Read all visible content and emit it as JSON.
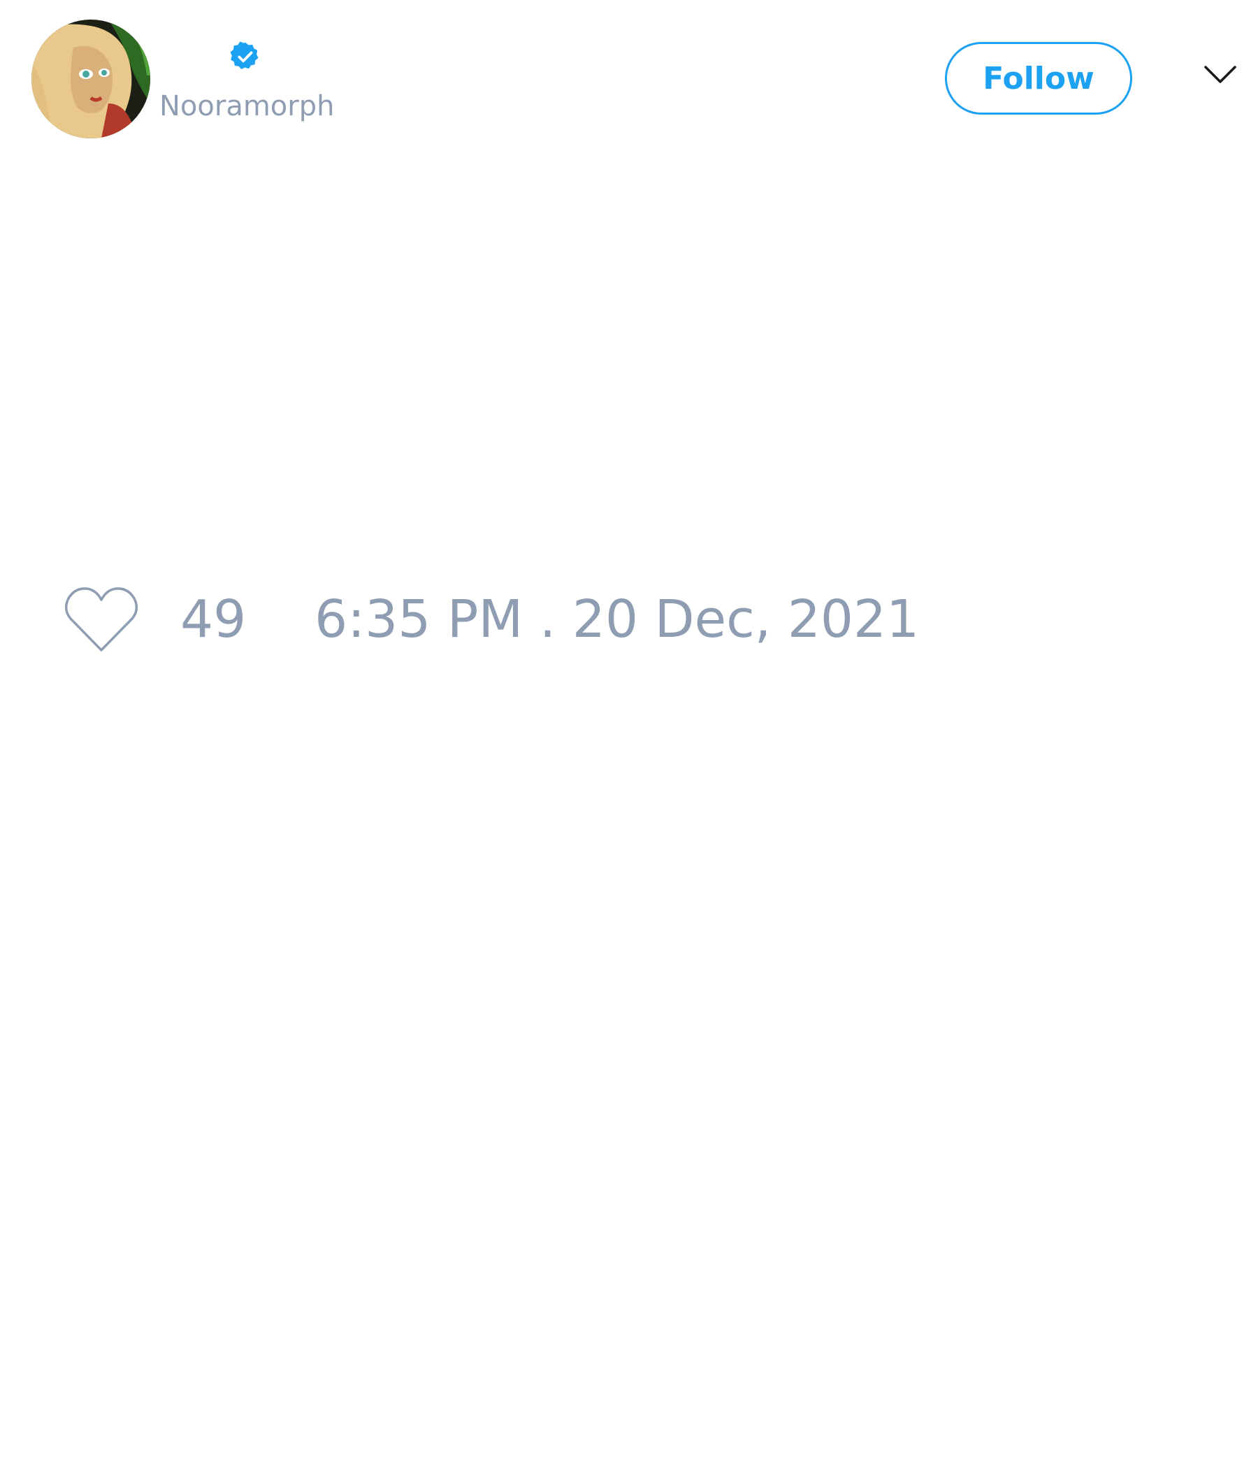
{
  "tweet": {
    "author": {
      "username": "Nooramorph",
      "verified": true,
      "avatar_icon": "cartoon-avatar"
    },
    "follow_label": "Follow",
    "menu_icon": "chevron-down-icon",
    "like_icon": "heart-outline-icon",
    "like_count": "49",
    "timestamp": "6:35 PM . 20 Dec, 2021"
  },
  "colors": {
    "accent": "#1da1f2",
    "muted_text": "#8f9db3",
    "background": "#ffffff"
  }
}
